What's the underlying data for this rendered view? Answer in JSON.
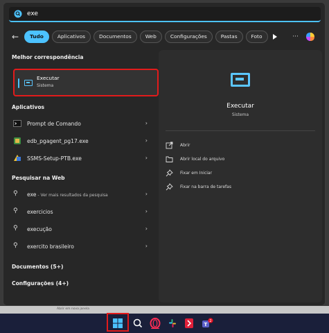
{
  "search": {
    "value": "exe"
  },
  "filters": [
    {
      "label": "Tudo"
    },
    {
      "label": "Aplicativos"
    },
    {
      "label": "Documentos"
    },
    {
      "label": "Web"
    },
    {
      "label": "Configurações"
    },
    {
      "label": "Pastas"
    },
    {
      "label": "Foto"
    }
  ],
  "more_label": "···",
  "sections": {
    "best_match": "Melhor correspondência",
    "apps": "Aplicativos",
    "web": "Pesquisar na Web",
    "documents": "Documentos (5+)",
    "settings": "Configurações (4+)"
  },
  "best_match": {
    "name": "Executar",
    "subtitle": "Sistema"
  },
  "apps": [
    {
      "name": "Prompt de Comando"
    },
    {
      "name": "edb_pgagent_pg17.exe"
    },
    {
      "name": "SSMS-Setup-PTB.exe"
    }
  ],
  "web_results": [
    {
      "query": "exe",
      "hint": " - Ver mais resultados da pesquisa"
    },
    {
      "query": "exercicios",
      "hint": ""
    },
    {
      "query": "execução",
      "hint": ""
    },
    {
      "query": "exercito brasileiro",
      "hint": ""
    }
  ],
  "preview": {
    "title": "Executar",
    "subtitle": "Sistema",
    "actions": [
      {
        "label": "Abrir",
        "icon": "open-icon"
      },
      {
        "label": "Abrir local do arquivo",
        "icon": "folder-icon"
      },
      {
        "label": "Fixar em Iniciar",
        "icon": "pin-icon"
      },
      {
        "label": "Fixar na barra de tarefas",
        "icon": "pin-icon"
      }
    ]
  },
  "background_text": "Abrir em nova janela",
  "taskbar": {
    "teams_badge": "2"
  },
  "colors": {
    "accent": "#4cc2ff",
    "highlight": "#e21b1b",
    "panel": "#272727",
    "taskbar": "#1a1f3a"
  }
}
